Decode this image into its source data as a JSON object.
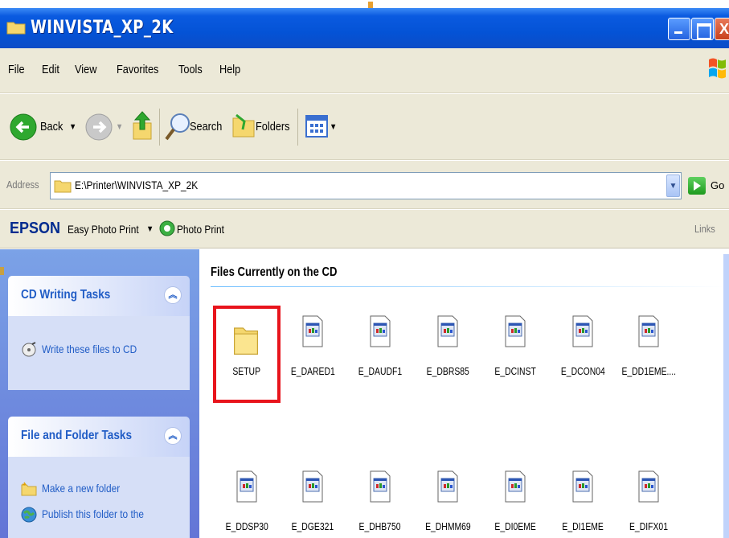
{
  "window": {
    "title": "WINVISTA_XP_2K"
  },
  "menu": [
    "File",
    "Edit",
    "View",
    "Favorites",
    "Tools",
    "Help"
  ],
  "toolbar": {
    "back_label": "Back",
    "search_label": "Search",
    "folders_label": "Folders"
  },
  "address": {
    "label": "Address",
    "value": "E:\\Printer\\WINVISTA_XP_2K",
    "go_label": "Go"
  },
  "epson_bar": {
    "logo": "EPSON",
    "easy_photo_print": "Easy Photo Print",
    "photo_print": "Photo Print",
    "links_label": "Links"
  },
  "left_pane": {
    "cd_tasks": {
      "title": "CD Writing Tasks",
      "items": [
        "Write these files to CD"
      ]
    },
    "file_tasks": {
      "title": "File and Folder Tasks",
      "items": [
        "Make a new folder",
        "Publish this folder to the"
      ]
    }
  },
  "content": {
    "group_title": "Files Currently on the CD",
    "files": [
      {
        "name": "SETUP",
        "type": "folder"
      },
      {
        "name": "E_DARED1",
        "type": "file"
      },
      {
        "name": "E_DAUDF1",
        "type": "file"
      },
      {
        "name": "E_DBRS85",
        "type": "file"
      },
      {
        "name": "E_DCINST",
        "type": "file"
      },
      {
        "name": "E_DCON04",
        "type": "file"
      },
      {
        "name": "E_DD1EME....",
        "type": "file"
      },
      {
        "name": "E_DDSP30",
        "type": "file"
      },
      {
        "name": "E_DGE321",
        "type": "file"
      },
      {
        "name": "E_DHB750",
        "type": "file"
      },
      {
        "name": "E_DHMM69",
        "type": "file"
      },
      {
        "name": "E_DI0EME",
        "type": "file"
      },
      {
        "name": "E_DI1EME",
        "type": "file"
      },
      {
        "name": "E_DIFX01",
        "type": "file"
      }
    ]
  },
  "colors": {
    "titlebar": "#0453d6",
    "highlight": "#e8141c",
    "task_link": "#215dc6"
  }
}
